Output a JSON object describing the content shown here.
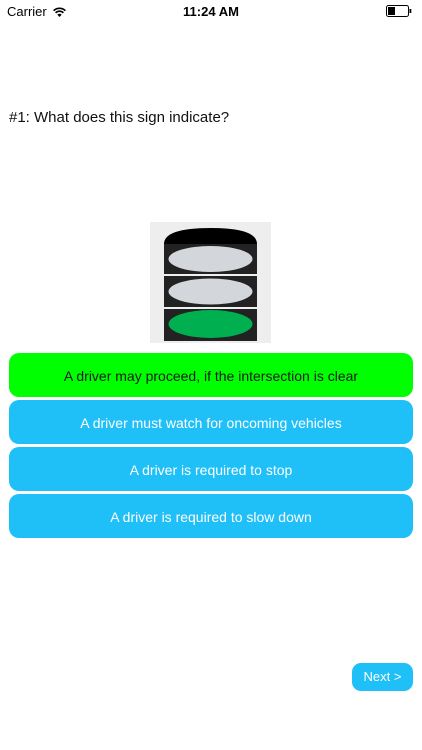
{
  "status_bar": {
    "carrier": "Carrier",
    "time": "11:24 AM"
  },
  "question": {
    "text": "#1: What does this sign indicate?"
  },
  "sign": {
    "icon": "traffic-light-green",
    "lit_color": "#00b050"
  },
  "answers": [
    {
      "label": "A driver may proceed, if the intersection is clear",
      "state": "correct"
    },
    {
      "label": "A driver must watch for oncoming vehicles",
      "state": "default"
    },
    {
      "label": "A driver is required to stop",
      "state": "default"
    },
    {
      "label": "A driver is required to slow down",
      "state": "default"
    }
  ],
  "navigation": {
    "next_label": "Next >"
  },
  "colors": {
    "correct": "#00ff00",
    "accent": "#1fbff7"
  }
}
